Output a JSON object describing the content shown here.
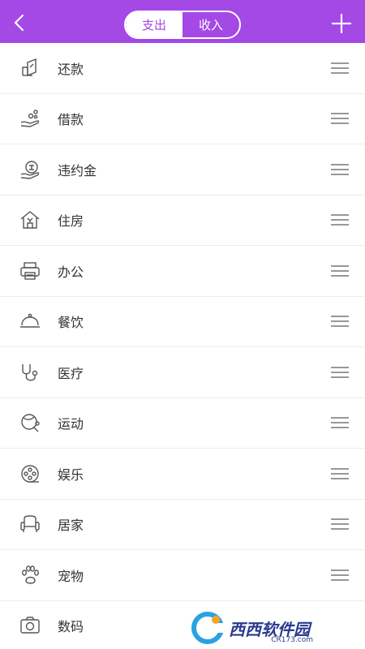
{
  "header": {
    "tabs": [
      {
        "label": "支出",
        "active": true
      },
      {
        "label": "收入",
        "active": false
      }
    ],
    "accent_color": "#a448e6"
  },
  "categories": [
    {
      "label": "还款",
      "icon": "repay-icon"
    },
    {
      "label": "借款",
      "icon": "borrow-icon"
    },
    {
      "label": "违约金",
      "icon": "penalty-icon"
    },
    {
      "label": "住房",
      "icon": "house-icon"
    },
    {
      "label": "办公",
      "icon": "printer-icon"
    },
    {
      "label": "餐饮",
      "icon": "dish-icon"
    },
    {
      "label": "医疗",
      "icon": "stethoscope-icon"
    },
    {
      "label": "运动",
      "icon": "pingpong-icon"
    },
    {
      "label": "娱乐",
      "icon": "film-reel-icon"
    },
    {
      "label": "居家",
      "icon": "armchair-icon"
    },
    {
      "label": "宠物",
      "icon": "paw-icon"
    },
    {
      "label": "数码",
      "icon": "camera-icon"
    }
  ],
  "watermark": {
    "text": "西西软件园",
    "url_text": "CR173.com"
  }
}
